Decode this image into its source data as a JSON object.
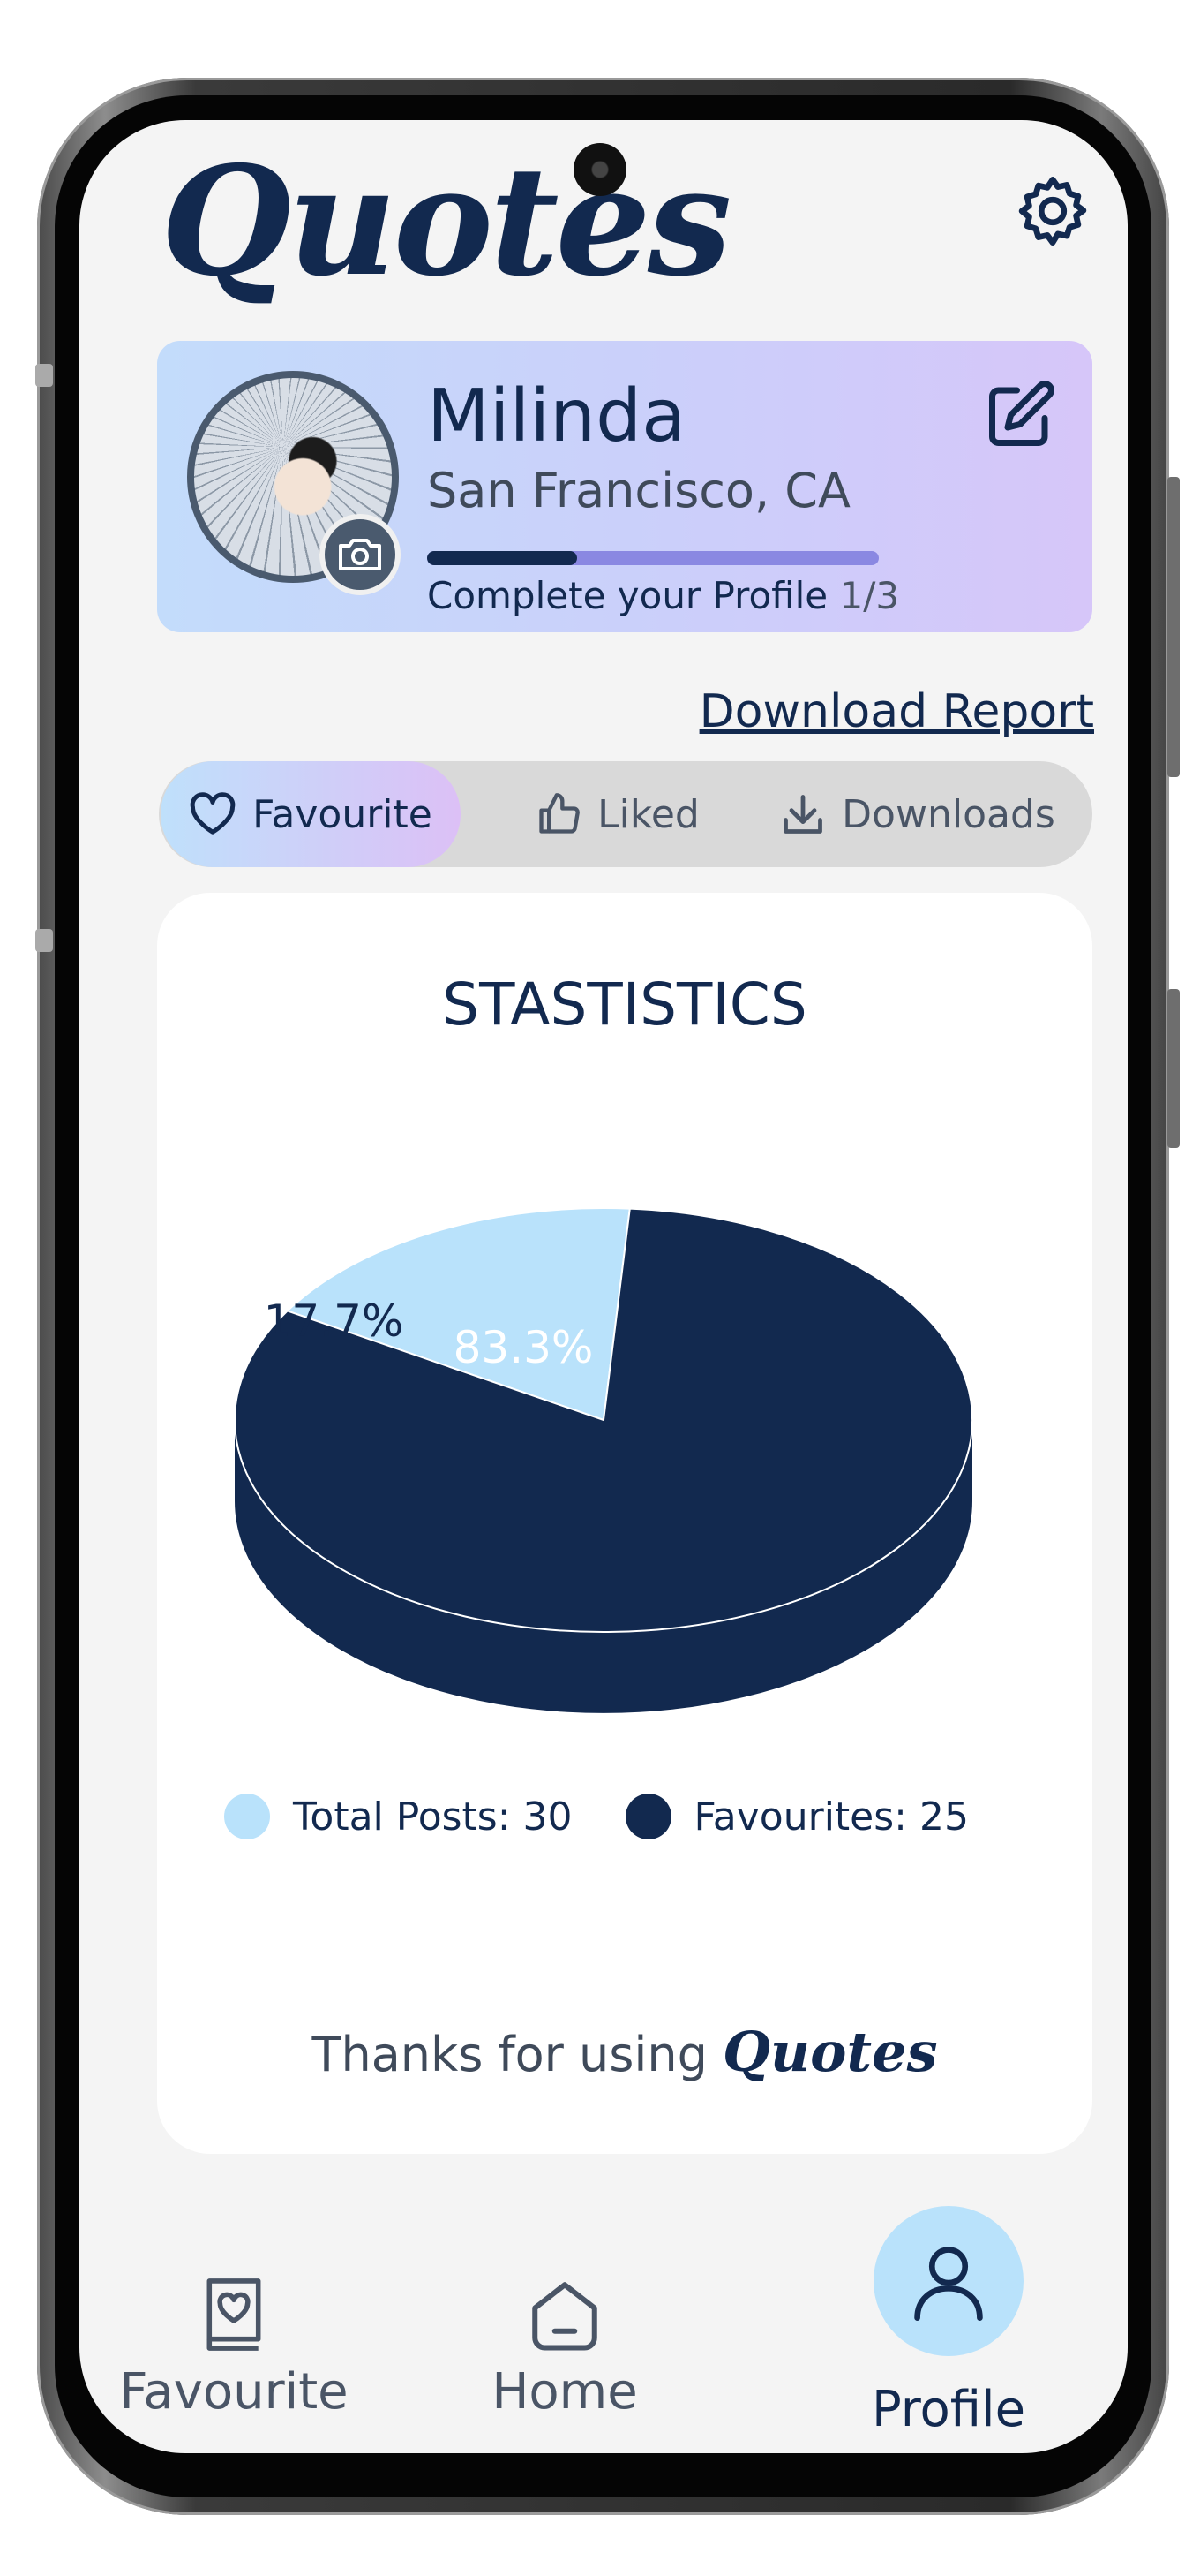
{
  "app": {
    "logo": "Quotes"
  },
  "profile": {
    "name": "Milinda",
    "location": "San Francisco, CA",
    "progress_text": "Complete your Profile",
    "progress_fraction": "1/3",
    "progress_value": 0.333
  },
  "actions": {
    "download_report": "Download Report"
  },
  "tabs": [
    {
      "label": "Favourite",
      "icon": "heart-icon",
      "active": true
    },
    {
      "label": "Liked",
      "icon": "thumbs-up-icon",
      "active": false
    },
    {
      "label": "Downloads",
      "icon": "download-icon",
      "active": false
    }
  ],
  "stats": {
    "title": "STASTISTICS",
    "footer_prefix": "Thanks for using",
    "footer_brand": "Quotes"
  },
  "chart_data": {
    "type": "pie",
    "title": "STASTISTICS",
    "slices": [
      {
        "label": "Total Posts: 30",
        "percent": 17.7,
        "display": "17.7%",
        "color": "#b9e2fb"
      },
      {
        "label": "Favourites: 25",
        "percent": 83.3,
        "display": "83.3%",
        "color": "#12294f"
      }
    ],
    "legend_position": "bottom"
  },
  "nav": [
    {
      "label": "Favourite",
      "icon": "book-heart-icon",
      "active": false
    },
    {
      "label": "Home",
      "icon": "home-icon",
      "active": false
    },
    {
      "label": "Profile",
      "icon": "user-icon",
      "active": true
    }
  ],
  "colors": {
    "primary": "#12294f",
    "accent_light": "#b9e2fb",
    "card_gradient_start": "#c3dcfb",
    "card_gradient_end": "#d6c6f9",
    "progress_track": "#8a88e2"
  }
}
